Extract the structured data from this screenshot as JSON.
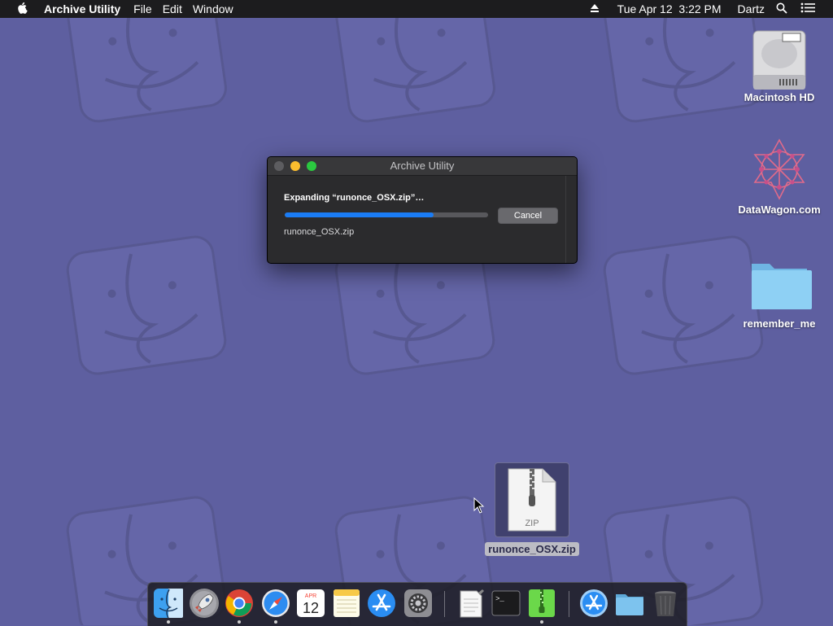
{
  "menubar": {
    "app_name": "Archive Utility",
    "menus": [
      "File",
      "Edit",
      "Window"
    ],
    "clock": "Tue Apr 12  3:22 PM",
    "user": "Dartz"
  },
  "desktop": {
    "icons": [
      {
        "label": "Macintosh HD"
      },
      {
        "label": "DataWagon.com"
      },
      {
        "label": "remember_me"
      }
    ],
    "zip_file": {
      "label": "runonce_OSX.zip",
      "badge": "ZIP"
    }
  },
  "dialog": {
    "title": "Archive Utility",
    "status": "Expanding “runonce_OSX.zip”…",
    "progress": 0.73,
    "cancel_label": "Cancel",
    "filename": "runonce_OSX.zip"
  },
  "dock": {
    "calendar_month": "APR",
    "calendar_day": "12",
    "terminal_prompt": ">_"
  },
  "colors": {
    "wallpaper": "#5e5fa0",
    "progress_fill": "#1a7cf5",
    "menubar": "#1c1c1e"
  }
}
